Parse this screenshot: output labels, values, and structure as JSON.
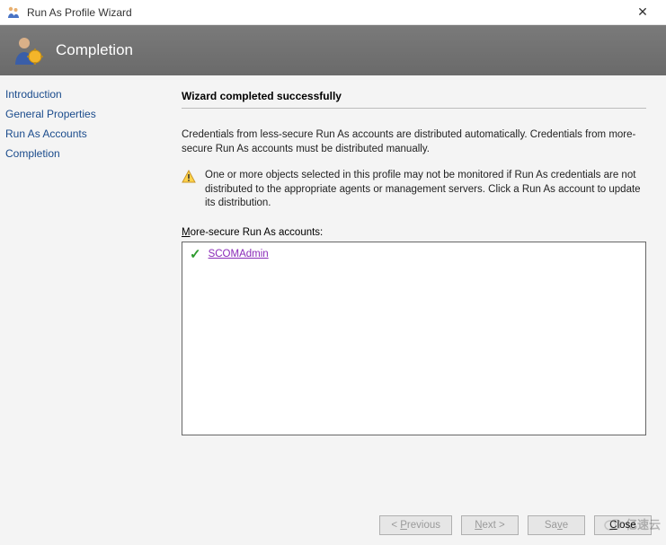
{
  "window": {
    "title": "Run As Profile Wizard"
  },
  "banner": {
    "title": "Completion"
  },
  "sidebar": {
    "items": [
      {
        "label": "Introduction"
      },
      {
        "label": "General Properties"
      },
      {
        "label": "Run As Accounts"
      },
      {
        "label": "Completion"
      }
    ]
  },
  "content": {
    "heading": "Wizard completed successfully",
    "description": "Credentials from less-secure Run As accounts are distributed automatically. Credentials from more-secure Run As accounts must be distributed manually.",
    "warning": "One or more objects selected in this profile may not be monitored if Run As credentials are not distributed to the appropriate agents or management servers. Click a Run As account to update its distribution.",
    "list_label_prefix": "M",
    "list_label_rest": "ore-secure Run As accounts:",
    "accounts": [
      {
        "name": "SCOMAdmin",
        "status": "ok"
      }
    ]
  },
  "buttons": {
    "previous_hotkey": "P",
    "previous_rest": "revious",
    "next_hotkey": "N",
    "next_rest": "ext >",
    "save_pre": "Sa",
    "save_hotkey": "v",
    "save_post": "e",
    "close_pre": "",
    "close_hotkey": "C",
    "close_post": "lose"
  },
  "watermark": {
    "text": "亿速云"
  }
}
